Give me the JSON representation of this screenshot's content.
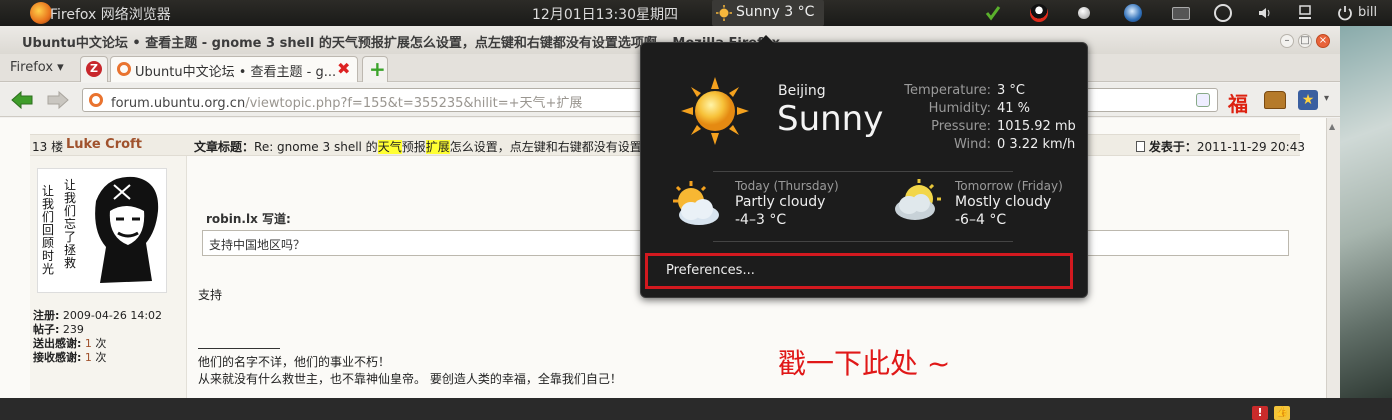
{
  "panel": {
    "app_menu": "Firefox 网络浏览器",
    "clock": "12月01日13:30星期四",
    "weather_indicator": "Sunny 3 °C",
    "user": "bill",
    "tray_icons": [
      "check-icon",
      "qq-icon",
      "record-icon",
      "thunderbird-icon",
      "keyboard-icon",
      "accessibility-icon",
      "volume-icon",
      "network-icon",
      "power-icon"
    ]
  },
  "window": {
    "title": "Ubuntu中文论坛 • 查看主题 - gnome 3 shell 的天气预报扩展怎么设置，点左键和右键都没有设置选项啊 – Mozilla Firefox"
  },
  "tabs": {
    "firefox_menu": "Firefox",
    "active_tab_label": "Ubuntu中文论坛 • 查看主题 - g...",
    "new_tab_symbol": "+"
  },
  "urlbar": {
    "host": "forum.ubuntu.org.cn",
    "path": "/viewtopic.php?f=155&t=355235&hilit=+天气+扩展"
  },
  "post": {
    "floor": "13 楼",
    "author": "Luke Croft",
    "subject_label": "文章标题：",
    "subject_pre": "Re: gnome 3 shell 的",
    "subject_hl1": "天气",
    "subject_mid": "预报",
    "subject_hl2": "扩展",
    "subject_post": "怎么设置，点左键和右键都没有设置选项啊",
    "posted_label": "发表于：",
    "posted_date": "2011-11-29 20:43",
    "quote_author": "robin.lx 写道:",
    "quote_text": "支持中国地区吗？",
    "reply": "支持",
    "sig_line1": "他们的名字不详，他们的事业不朽！",
    "sig_line2": "从来就没有什么救世主，也不靠神仙皇帝。 要创造人类的幸福，全靠我们自己！",
    "avatar_text_left": "让我们回顾时光",
    "avatar_text_right": "让我们忘了拯救",
    "stats": {
      "reg_label": "注册:",
      "reg_value": "2009-04-26 14:02",
      "posts_label": "帖子:",
      "posts_value": "239",
      "thanks_sent_label": "送出感谢:",
      "thanks_sent_value": "1",
      "thanks_sent_unit": " 次",
      "thanks_recv_label": "接收感谢:",
      "thanks_recv_value": "1",
      "thanks_recv_unit": " 次"
    }
  },
  "weather": {
    "city": "Beijing",
    "condition": "Sunny",
    "temperature_label": "Temperature:",
    "temperature": "3 °C",
    "humidity_label": "Humidity:",
    "humidity": "41 %",
    "pressure_label": "Pressure:",
    "pressure": "1015.92 mb",
    "wind_label": "Wind:",
    "wind": "0 3.22 km/h",
    "today_label": "Today (Thursday)",
    "today_condition": "Partly cloudy",
    "today_temp": "-4–3 °C",
    "tomorrow_label": "Tomorrow (Friday)",
    "tomorrow_condition": "Mostly cloudy",
    "tomorrow_temp": "-6–4 °C",
    "preferences": "Preferences..."
  },
  "annotation": {
    "text": "戳一下此处 ~",
    "color": "#e01818"
  }
}
